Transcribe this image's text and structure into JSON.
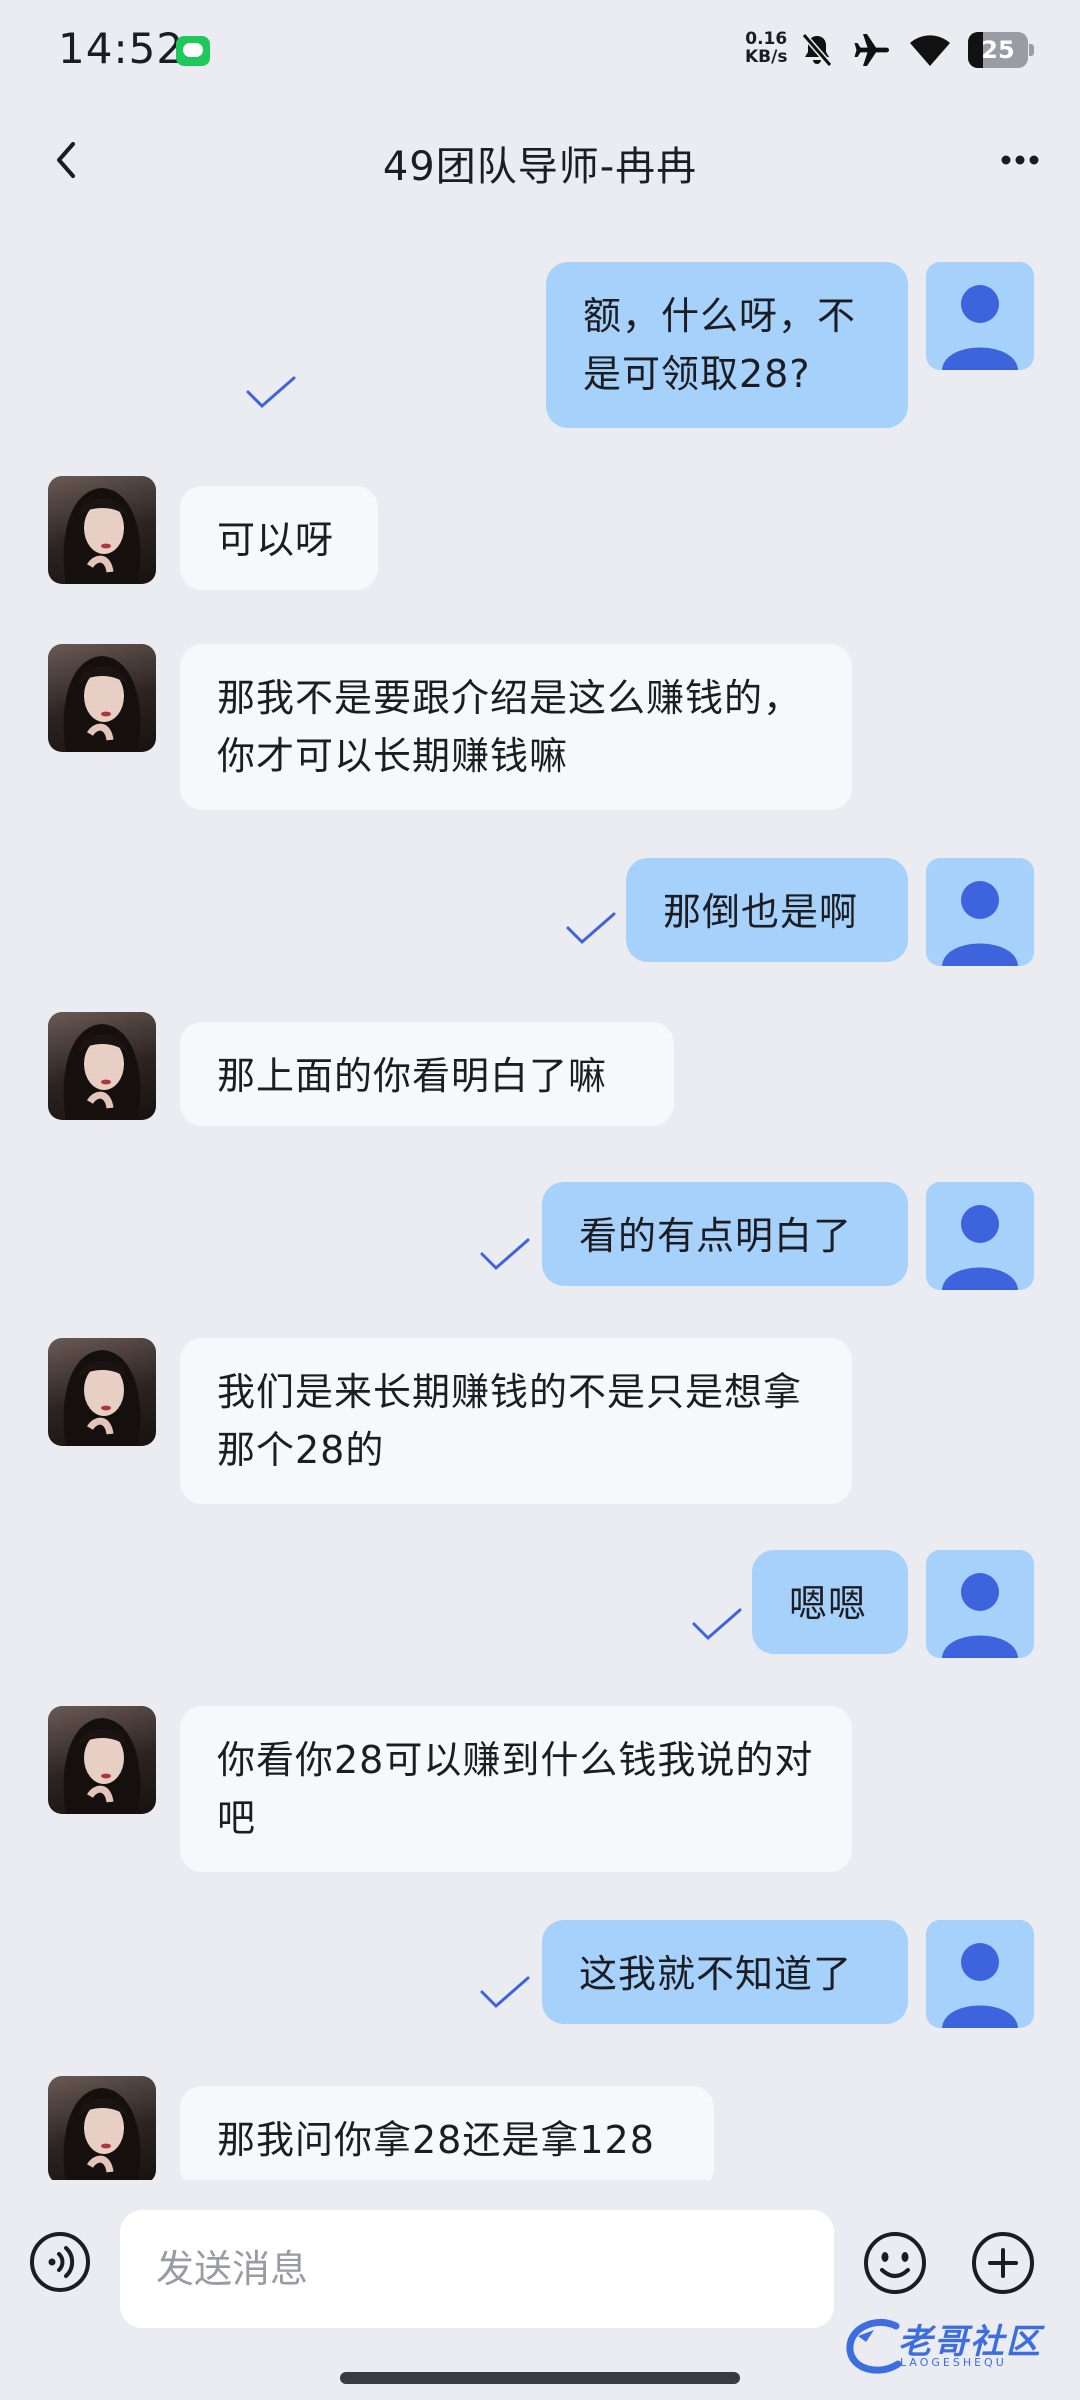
{
  "status_bar": {
    "time": "14:52",
    "net_speed_value": "0.16",
    "net_speed_unit": "KB/s",
    "battery": "25",
    "battery_level": 0.25,
    "icons": [
      "wechat-icon",
      "mute-bell-icon",
      "airplane-icon",
      "wifi-icon",
      "battery-icon"
    ]
  },
  "header": {
    "title": "49团队导师-冉冉",
    "back_icon": "chevron-left-icon",
    "more_icon": "more-dots-icon"
  },
  "messages": [
    {
      "direction": "out",
      "text": "额，什么呀，不是可领取28?",
      "read": true
    },
    {
      "direction": "in",
      "text": "可以呀"
    },
    {
      "direction": "in",
      "text": "那我不是要跟介绍是这么赚钱的，你才可以长期赚钱嘛"
    },
    {
      "direction": "out",
      "text": "那倒也是啊",
      "read": true
    },
    {
      "direction": "in",
      "text": "那上面的你看明白了嘛"
    },
    {
      "direction": "out",
      "text": "看的有点明白了",
      "read": true
    },
    {
      "direction": "in",
      "text": "我们是来长期赚钱的不是只是想拿那个28的"
    },
    {
      "direction": "out",
      "text": "嗯嗯",
      "read": true
    },
    {
      "direction": "in",
      "text": "你看你28可以赚到什么钱我说的对吧"
    },
    {
      "direction": "out",
      "text": "这我就不知道了",
      "read": true
    },
    {
      "direction": "in",
      "text": "那我问你拿28还是拿128"
    }
  ],
  "input_bar": {
    "placeholder": "发送消息",
    "voice_icon": "voice-icon",
    "emoji_icon": "emoji-icon",
    "plus_icon": "plus-circle-icon"
  },
  "watermark": {
    "text": "老哥社区",
    "sub": "LAOGESHEQU"
  },
  "colors": {
    "background": "#ebecf2",
    "outgoing_bubble": "#a6d1fb",
    "incoming_bubble": "#f7f8fc",
    "accent": "#3d63dd"
  }
}
